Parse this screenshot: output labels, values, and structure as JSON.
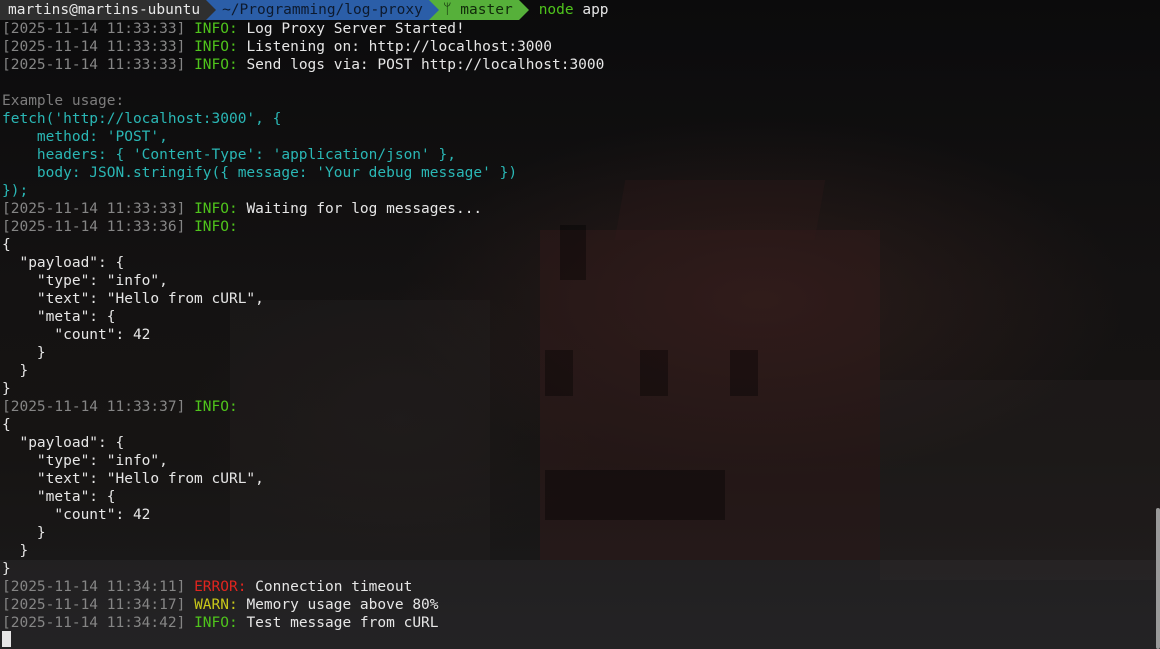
{
  "prompt": {
    "user_host": "martins@martins-ubuntu",
    "path": "~/Programming/log-proxy",
    "git_icon": "ᛘ",
    "branch": "master",
    "command": "node",
    "command_arg": "app"
  },
  "colors": {
    "info": "#4fc41c",
    "warn": "#c8c81a",
    "error": "#e0251f",
    "timestamp": "#858585",
    "code": "#2ab7b5",
    "prompt_path_bg": "#2b5ea8",
    "prompt_git_bg": "#56b03a"
  },
  "lines": [
    {
      "ts": "[2025-11-14 11:33:33]",
      "level": "INFO:",
      "msg": " Log Proxy Server Started!"
    },
    {
      "ts": "[2025-11-14 11:33:33]",
      "level": "INFO:",
      "msg": " Listening on: http://localhost:3000"
    },
    {
      "ts": "[2025-11-14 11:33:33]",
      "level": "INFO:",
      "msg": " Send logs via: POST http://localhost:3000"
    }
  ],
  "example": {
    "heading": "Example usage:",
    "code": [
      "fetch('http://localhost:3000', {",
      "    method: 'POST',",
      "    headers: { 'Content-Type': 'application/json' },",
      "    body: JSON.stringify({ message: 'Your debug message' })",
      "});"
    ]
  },
  "waiting": {
    "ts": "[2025-11-14 11:33:33]",
    "level": "INFO:",
    "msg": " Waiting for log messages..."
  },
  "entry1": {
    "ts": "[2025-11-14 11:33:36]",
    "level": "INFO:",
    "json": [
      "{",
      "  \"payload\": {",
      "    \"type\": \"info\",",
      "    \"text\": \"Hello from cURL\",",
      "    \"meta\": {",
      "      \"count\": 42",
      "    }",
      "  }",
      "}"
    ]
  },
  "entry2": {
    "ts": "[2025-11-14 11:33:37]",
    "level": "INFO:",
    "json": [
      "{",
      "  \"payload\": {",
      "    \"type\": \"info\",",
      "    \"text\": \"Hello from cURL\",",
      "    \"meta\": {",
      "      \"count\": 42",
      "    }",
      "  }",
      "}"
    ]
  },
  "tail": [
    {
      "ts": "[2025-11-14 11:34:11]",
      "level": "ERROR:",
      "msg": " Connection timeout",
      "kind": "error"
    },
    {
      "ts": "[2025-11-14 11:34:17]",
      "level": "WARN:",
      "msg": " Memory usage above 80%",
      "kind": "warn"
    },
    {
      "ts": "[2025-11-14 11:34:42]",
      "level": "INFO:",
      "msg": " Test message from cURL",
      "kind": "info"
    }
  ]
}
